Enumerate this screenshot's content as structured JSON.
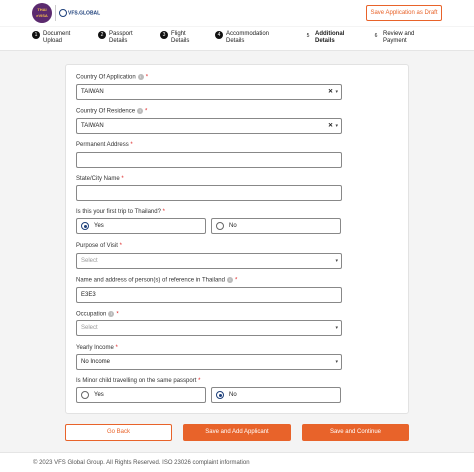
{
  "header": {
    "brand_logo": "THAI eVISA",
    "vfs_logo": "VFS.GLOBAL",
    "save_draft_label": "Save Application as Draft"
  },
  "steps": [
    {
      "num": "1",
      "label": "Document Upload",
      "state": "done"
    },
    {
      "num": "2",
      "label": "Passport Details",
      "state": "done"
    },
    {
      "num": "3",
      "label": "Flight Details",
      "state": "done"
    },
    {
      "num": "4",
      "label": "Accommodation Details",
      "state": "done"
    },
    {
      "num": "5",
      "label": "Additional Details",
      "state": "active"
    },
    {
      "num": "6",
      "label": "Review and Payment",
      "state": "pending"
    }
  ],
  "form": {
    "country_application": {
      "label": "Country Of Application",
      "value": "TAIWAN"
    },
    "country_residence": {
      "label": "Country Of Residence",
      "value": "TAIWAN"
    },
    "permanent_address": {
      "label": "Permanent Address",
      "value": ""
    },
    "state_city": {
      "label": "State/City Name",
      "value": ""
    },
    "first_trip": {
      "label": "Is this your first trip to Thailand?",
      "yes": "Yes",
      "no": "No",
      "selected": "Yes"
    },
    "purpose": {
      "label": "Purpose of Visit",
      "placeholder": "Select"
    },
    "reference": {
      "label": "Name and address of person(s) of reference in Thailand",
      "value": "E3E3"
    },
    "occupation": {
      "label": "Occupation",
      "placeholder": "Select"
    },
    "yearly_income": {
      "label": "Yearly Income",
      "value": "No Income"
    },
    "minor_child": {
      "label": "Is Minor child travelling on the same passport",
      "yes": "Yes",
      "no": "No",
      "selected": "No"
    },
    "required_mark": "*",
    "info_glyph": "i"
  },
  "actions": {
    "back": "Go Back",
    "save_add": "Save and Add Applicant",
    "save_continue": "Save and Continue"
  },
  "footer": {
    "text": "© 2023 VFS Global Group. All Rights Reserved. ISO 23026 complaint information"
  },
  "colors": {
    "accent": "#e8632a",
    "brand": "#5b2a6e",
    "selected_radio": "#1d3f7a"
  }
}
